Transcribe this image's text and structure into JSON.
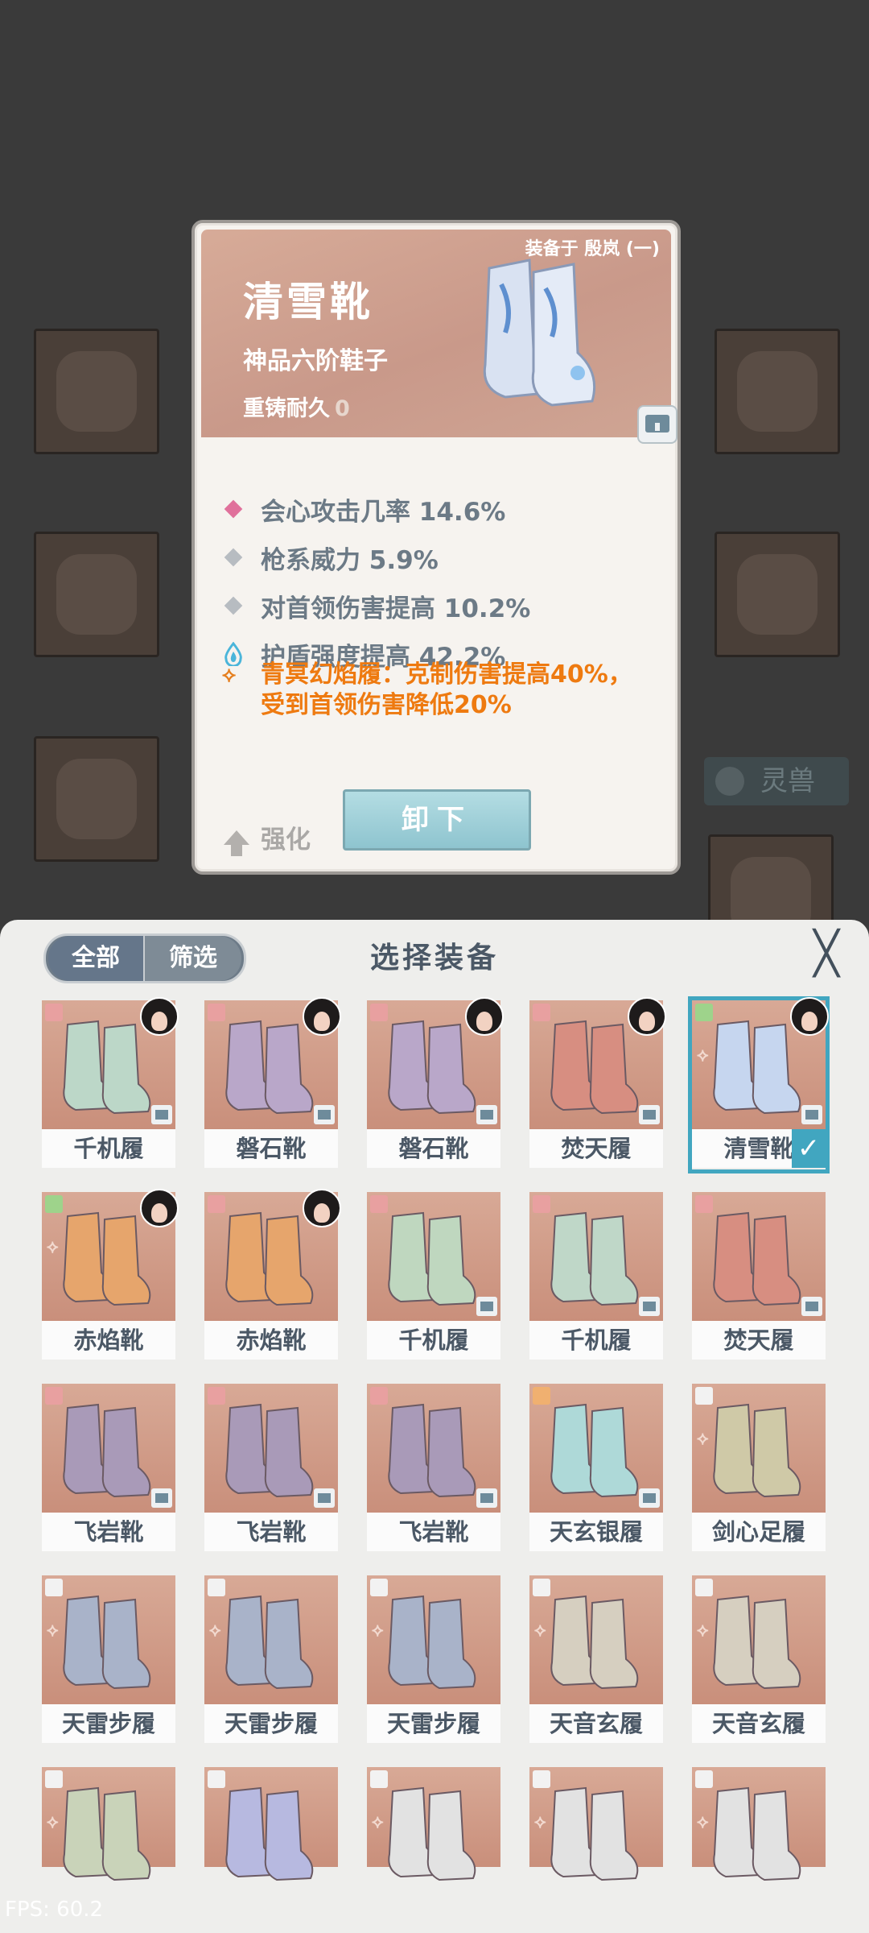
{
  "background": {
    "tag_label": "灵兽"
  },
  "detail": {
    "equipped_on": "装备于 殷岚 (一)",
    "name": "清雪靴",
    "grade": "神品六阶鞋子",
    "durability_label": "重铸耐久",
    "durability_value": "0",
    "stats": [
      {
        "text": "会心攻击几率 14.6%",
        "bullet": "diamond",
        "color": "#e0709b"
      },
      {
        "text": "枪系威力 5.9%",
        "bullet": "diamond",
        "color": "#b7bcc1"
      },
      {
        "text": "对首领伤害提高 10.2%",
        "bullet": "diamond",
        "color": "#b7bcc1"
      },
      {
        "text": "护盾强度提高 42.2%",
        "bullet": "water-drop-icon",
        "color": "#4ab5da"
      }
    ],
    "set_bonus": {
      "line1": "青冥幻焰履：克制伤害提高40%，",
      "line2": "受到首领伤害降低20%"
    },
    "upgrade_label": "强化",
    "unequip_label": "卸下"
  },
  "panel": {
    "tab_all": "全部",
    "tab_filter": "筛选",
    "title": "选择装备",
    "close_symbol": "╳"
  },
  "items": [
    {
      "name": "千机履",
      "tone": "#bcd7c8",
      "corner": "#e8a0a0",
      "avatar": true,
      "lock": true
    },
    {
      "name": "磐石靴",
      "tone": "#b9a7c9",
      "corner": "#e8a0a0",
      "avatar": true,
      "lock": true
    },
    {
      "name": "磐石靴",
      "tone": "#b9a7c9",
      "corner": "#e8a0a0",
      "avatar": true,
      "lock": true
    },
    {
      "name": "焚天履",
      "tone": "#d78e81",
      "corner": "#e8a0a0",
      "avatar": true,
      "lock": true
    },
    {
      "name": "清雪靴",
      "tone": "#c6d6ef",
      "corner": "#9ed38b",
      "avatar": true,
      "lock": true,
      "selected": true,
      "sub": "⟡"
    },
    {
      "name": "赤焰靴",
      "tone": "#e6a56c",
      "corner": "#9ed38b",
      "avatar": true,
      "lock": false,
      "sub": "⟡"
    },
    {
      "name": "赤焰靴",
      "tone": "#e6a56c",
      "corner": "#e8a0a0",
      "avatar": true,
      "lock": false
    },
    {
      "name": "千机履",
      "tone": "#bfd7bf",
      "corner": "#e8a0a0",
      "avatar": false,
      "lock": true
    },
    {
      "name": "千机履",
      "tone": "#bfd7c8",
      "corner": "#e8a0a0",
      "avatar": false,
      "lock": true
    },
    {
      "name": "焚天履",
      "tone": "#d78e81",
      "corner": "#e8a0a0",
      "avatar": false,
      "lock": true
    },
    {
      "name": "飞岩靴",
      "tone": "#a99ab8",
      "corner": "#e8a0a0",
      "avatar": false,
      "lock": true
    },
    {
      "name": "飞岩靴",
      "tone": "#a99ab8",
      "corner": "#e8a0a0",
      "avatar": false,
      "lock": true
    },
    {
      "name": "飞岩靴",
      "tone": "#a99ab8",
      "corner": "#e8a0a0",
      "avatar": false,
      "lock": true
    },
    {
      "name": "天玄银履",
      "tone": "#aed9d8",
      "corner": "#f0b070",
      "avatar": false,
      "lock": true
    },
    {
      "name": "剑心足履",
      "tone": "#cfc9a7",
      "corner": "#f2f2f2",
      "avatar": false,
      "lock": false,
      "sub": "⟡"
    },
    {
      "name": "天雷步履",
      "tone": "#a9b3c9",
      "corner": "#f2f2f2",
      "avatar": false,
      "lock": false,
      "sub": "⟡"
    },
    {
      "name": "天雷步履",
      "tone": "#a9b3c9",
      "corner": "#f2f2f2",
      "avatar": false,
      "lock": false,
      "sub": "⟡"
    },
    {
      "name": "天雷步履",
      "tone": "#a9b3c9",
      "corner": "#f2f2f2",
      "avatar": false,
      "lock": false,
      "sub": "⟡"
    },
    {
      "name": "天音玄履",
      "tone": "#d6cfc0",
      "corner": "#f2f2f2",
      "avatar": false,
      "lock": false,
      "sub": "⟡"
    },
    {
      "name": "天音玄履",
      "tone": "#d6cfc0",
      "corner": "#f2f2f2",
      "avatar": false,
      "lock": false,
      "sub": "⟡"
    },
    {
      "name": "",
      "tone": "#c9d3b9",
      "corner": "#f2f2f2",
      "avatar": false,
      "lock": false,
      "sub": "⟡"
    },
    {
      "name": "",
      "tone": "#b7b9e0",
      "corner": "#f2f2f2",
      "avatar": false,
      "lock": false
    },
    {
      "name": "",
      "tone": "#e2e2e2",
      "corner": "#f2f2f2",
      "avatar": false,
      "lock": false,
      "sub": "⟡"
    },
    {
      "name": "",
      "tone": "#e2e2e2",
      "corner": "#f2f2f2",
      "avatar": false,
      "lock": false,
      "sub": "⟡"
    },
    {
      "name": "",
      "tone": "#e2e2e2",
      "corner": "#f2f2f2",
      "avatar": false,
      "lock": false,
      "sub": "⟡"
    }
  ],
  "fps": "FPS: 60.2"
}
